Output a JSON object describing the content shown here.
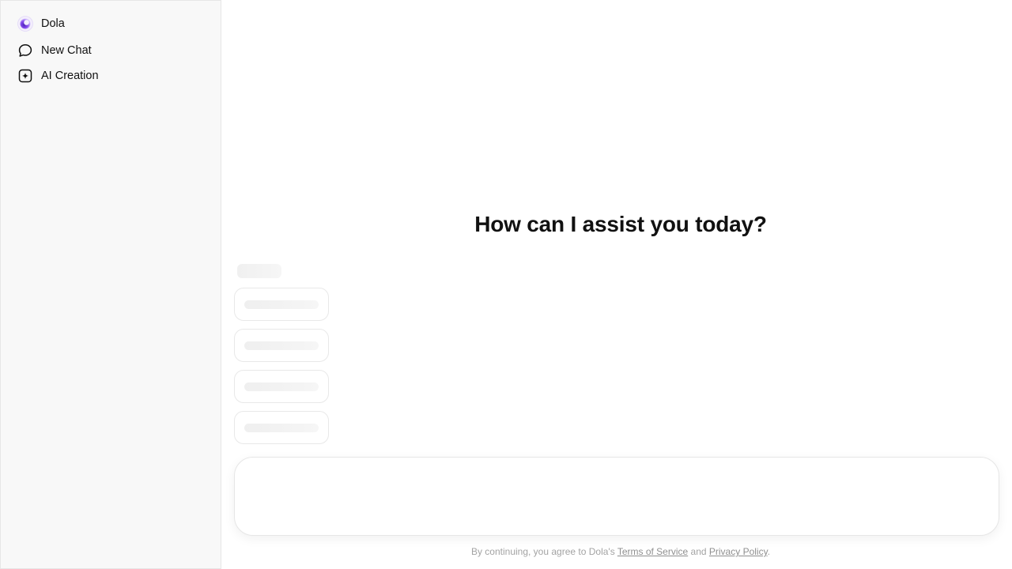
{
  "sidebar": {
    "items": [
      {
        "label": "Dola",
        "icon": "dola-logo-icon"
      },
      {
        "label": "New Chat",
        "icon": "chat-bubble-icon"
      },
      {
        "label": "AI Creation",
        "icon": "plus-sparkle-square-icon"
      }
    ]
  },
  "main": {
    "headline": "How can I assist you today?",
    "composer": {
      "placeholder": "",
      "value": ""
    }
  },
  "footer": {
    "prefix": "By continuing, you agree to Dola's ",
    "terms_label": "Terms of Service",
    "and": " and ",
    "privacy_label": "Privacy Policy",
    "suffix": "."
  },
  "colors": {
    "sidebar_bg": "#f8f8f8",
    "logo_purple": "#7b3fe4",
    "text": "#111111",
    "muted": "#a3a3a3"
  }
}
